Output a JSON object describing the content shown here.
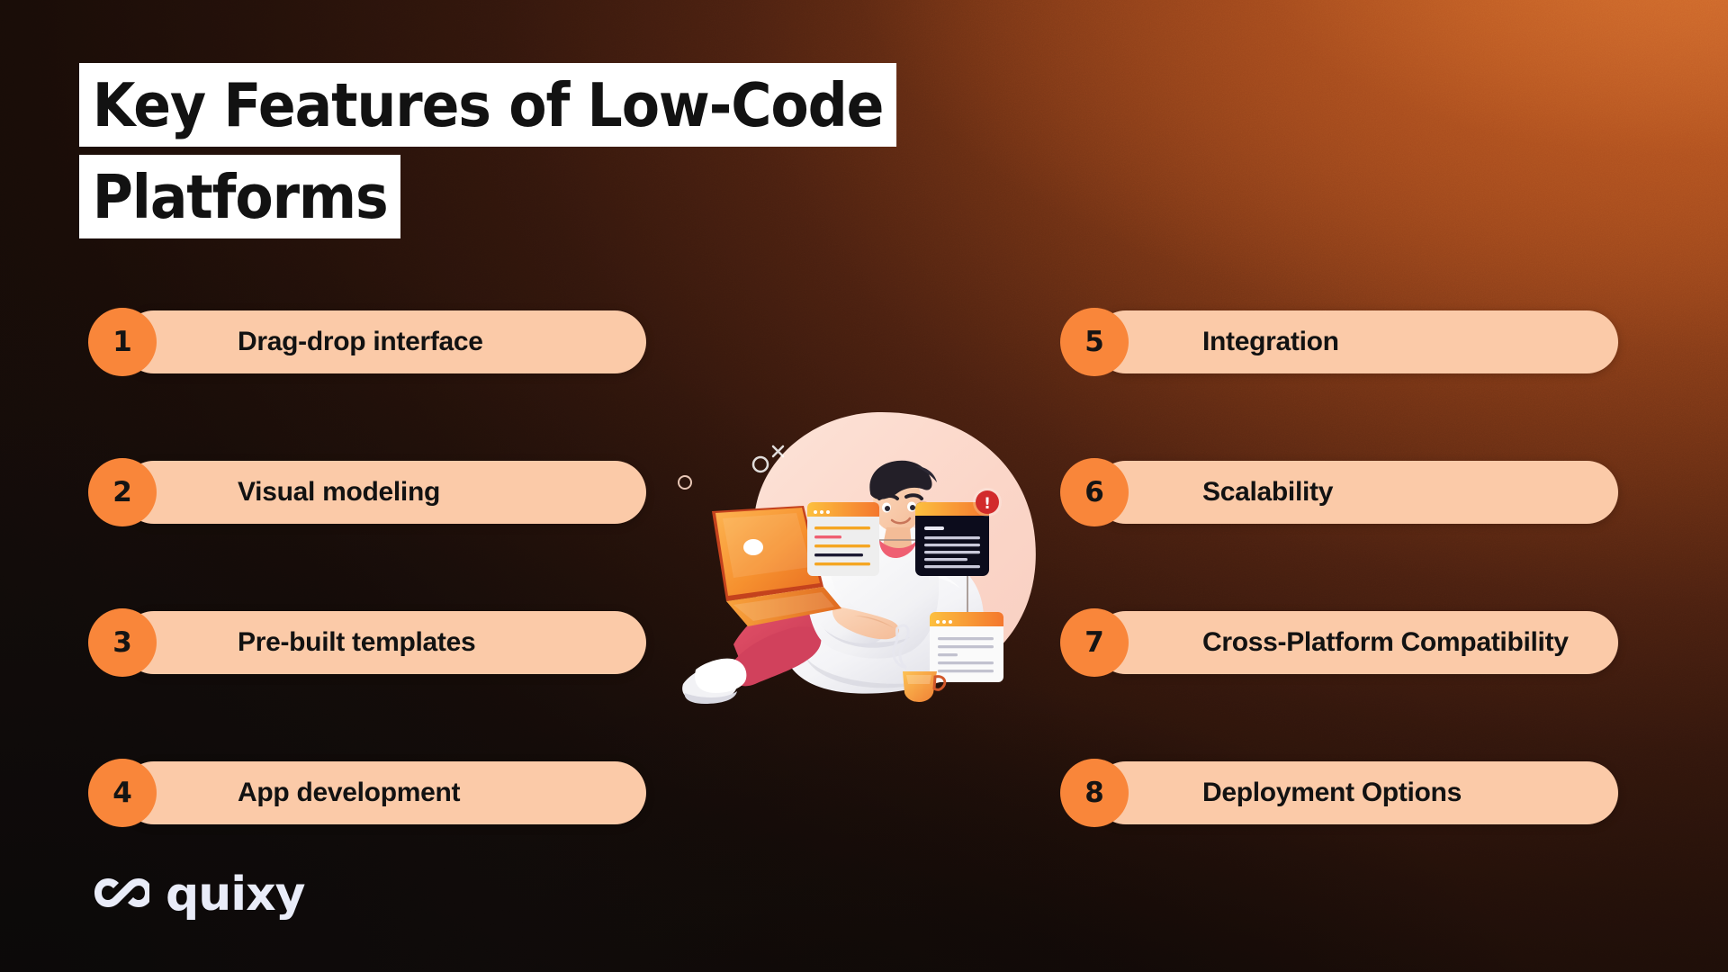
{
  "title": {
    "line1": "Key Features of Low-Code",
    "line2": "Platforms"
  },
  "features": {
    "left": [
      {
        "number": "1",
        "label": "Drag-drop interface"
      },
      {
        "number": "2",
        "label": "Visual modeling"
      },
      {
        "number": "3",
        "label": "Pre-built templates"
      },
      {
        "number": "4",
        "label": "App development"
      }
    ],
    "right": [
      {
        "number": "5",
        "label": "Integration"
      },
      {
        "number": "6",
        "label": "Scalability"
      },
      {
        "number": "7",
        "label": "Cross-Platform Compatibility"
      },
      {
        "number": "8",
        "label": "Deployment Options"
      }
    ]
  },
  "brand": {
    "name": "quixy",
    "logo_icon": "interlocking-loops-icon"
  },
  "illustration": {
    "alt": "man-on-beanbag-with-laptop-illustration",
    "alert_badge": "!",
    "elements": [
      "person-with-laptop",
      "beanbag-chair",
      "ui-window-card-light",
      "ui-window-card-dark",
      "ui-window-card-light-lower",
      "alert-badge",
      "coffee-cup"
    ]
  },
  "colors": {
    "background_dark": "#141010",
    "background_accent": "#b0511f",
    "pill_bg": "#fbcaa8",
    "badge_bg": "#f9863a",
    "title_bg": "#ffffff",
    "title_text": "#121212",
    "logo_text": "#e9ecf8",
    "alert_red": "#d22b2b"
  }
}
